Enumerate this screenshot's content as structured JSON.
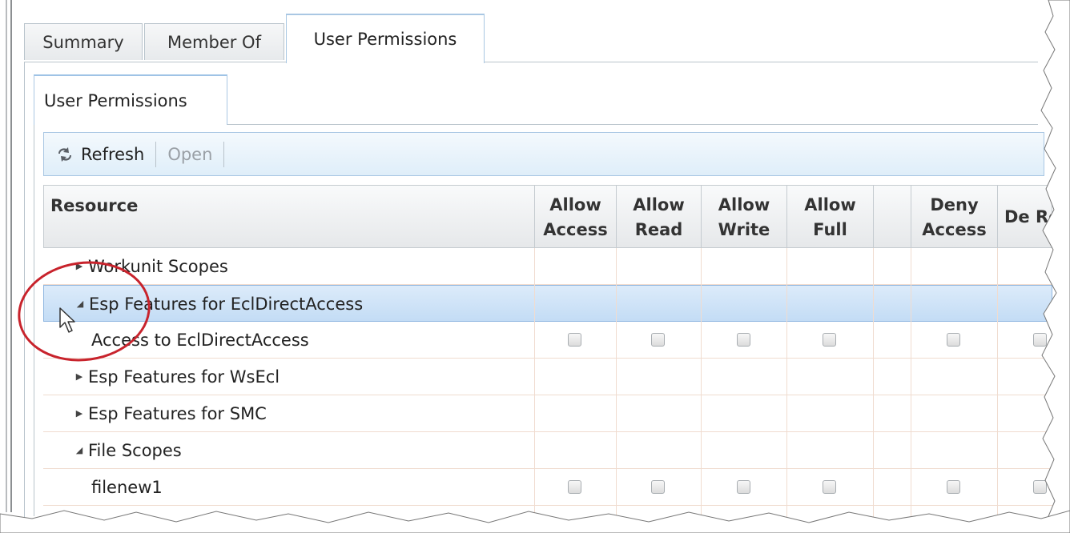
{
  "outer_tabs": [
    "Summary",
    "Member Of",
    "User Permissions"
  ],
  "outer_active_tab": "User Permissions",
  "inner_tab": "User Permissions",
  "toolbar": {
    "refresh_label": "Refresh",
    "open_label": "Open"
  },
  "grid": {
    "columns": [
      {
        "key": "resource",
        "label": "Resource"
      },
      {
        "key": "allow_access",
        "label": "Allow Access"
      },
      {
        "key": "allow_read",
        "label": "Allow Read"
      },
      {
        "key": "allow_write",
        "label": "Allow Write"
      },
      {
        "key": "allow_full",
        "label": "Allow Full"
      },
      {
        "key": "blank",
        "label": ""
      },
      {
        "key": "deny_access",
        "label": "Deny Access"
      },
      {
        "key": "deny_read",
        "label": "De Re"
      }
    ],
    "rows": [
      {
        "label": "Workunit Scopes",
        "expander": "collapsed",
        "has_checkboxes": false,
        "selected": false
      },
      {
        "label": "Esp Features for EclDirectAccess",
        "expander": "expanded",
        "has_checkboxes": false,
        "selected": true
      },
      {
        "label": "Access to EclDirectAccess",
        "expander": "none",
        "has_checkboxes": true,
        "selected": false
      },
      {
        "label": "Esp Features for WsEcl",
        "expander": "collapsed",
        "has_checkboxes": false,
        "selected": false
      },
      {
        "label": "Esp Features for SMC",
        "expander": "collapsed",
        "has_checkboxes": false,
        "selected": false
      },
      {
        "label": "File Scopes",
        "expander": "expanded",
        "has_checkboxes": false,
        "selected": false
      },
      {
        "label": "filenew1",
        "expander": "none",
        "has_checkboxes": true,
        "selected": false
      }
    ]
  },
  "colors": {
    "annotation": "#c8232c",
    "selection": "#c3dcf5",
    "toolbar": "#dfeef9"
  }
}
